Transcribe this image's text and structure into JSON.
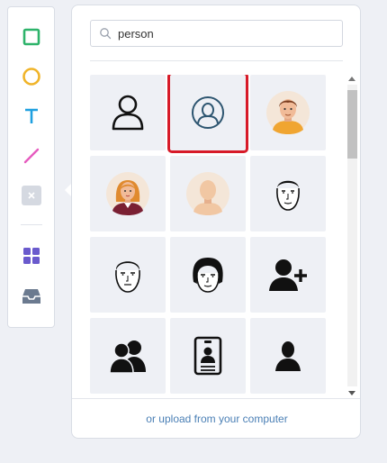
{
  "toolbar": {
    "tools": [
      "rectangle-tool",
      "circle-tool",
      "text-tool",
      "line-tool",
      "clear-tool",
      "apps-tool",
      "inbox-tool"
    ],
    "colors": {
      "rectangle": "#2db36a",
      "circle": "#f0b429",
      "text": "#1fa0e0",
      "line": "#e65bbf",
      "apps": "#6a5acd",
      "inbox": "#6b7a8f"
    }
  },
  "search": {
    "value": "person"
  },
  "results": {
    "icons": [
      "person-outline-icon",
      "person-circle-icon",
      "man-avatar-icon",
      "woman-avatar-icon",
      "person-silhouette-avatar-icon",
      "man-face-sketch-icon",
      "man-face-sketch-2-icon",
      "man-face-sketch-3-icon",
      "add-user-icon",
      "group-icon",
      "id-badge-icon",
      "person-solid-icon"
    ],
    "selected_index": 1
  },
  "footer": {
    "upload_label": "or upload from your computer"
  },
  "colors": {
    "selected_outline": "#d71a28",
    "link": "#4a7fb5",
    "tile_bg": "#eef0f5"
  }
}
